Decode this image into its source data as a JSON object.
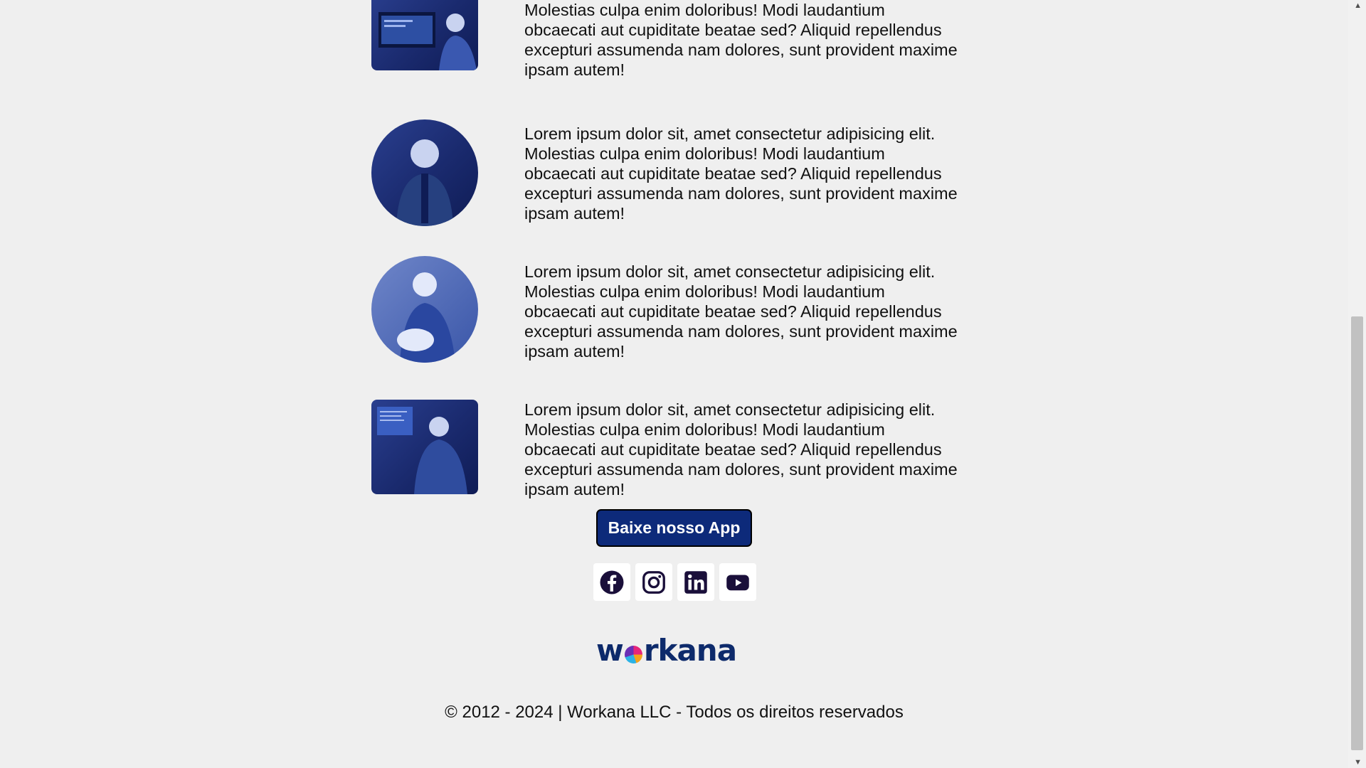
{
  "features": [
    {
      "text": "Lorem ipsum dolor sit, amet consectetur adipisicing elit. Molestias culpa enim doloribus! Modi laudantium obcaecati aut cupiditate beatae sed? Aliquid repellendus excepturi assumenda nam dolores, sunt provident maxime ipsam autem!"
    },
    {
      "text": "Lorem ipsum dolor sit, amet consectetur adipisicing elit. Molestias culpa enim doloribus! Modi laudantium obcaecati aut cupiditate beatae sed? Aliquid repellendus excepturi assumenda nam dolores, sunt provident maxime ipsam autem!"
    },
    {
      "text": "Lorem ipsum dolor sit, amet consectetur adipisicing elit. Molestias culpa enim doloribus! Modi laudantium obcaecati aut cupiditate beatae sed? Aliquid repellendus excepturi assumenda nam dolores, sunt provident maxime ipsam autem!"
    },
    {
      "text": "Lorem ipsum dolor sit, amet consectetur adipisicing elit. Molestias culpa enim doloribus! Modi laudantium obcaecati aut cupiditate beatae sed? Aliquid repellendus excepturi assumenda nam dolores, sunt provident maxime ipsam autem!"
    }
  ],
  "app_button": {
    "label": "Baixe nosso App"
  },
  "socials": [
    "facebook-icon",
    "instagram-icon",
    "linkedin-icon",
    "youtube-icon"
  ],
  "logo": {
    "text_before": "w",
    "text_after": "rkana"
  },
  "footer": {
    "copyright": "© 2012 - 2024 | Workana LLC - Todos os direitos reservados"
  },
  "colors": {
    "brand": "#0d2a7a",
    "background": "#efefef"
  }
}
